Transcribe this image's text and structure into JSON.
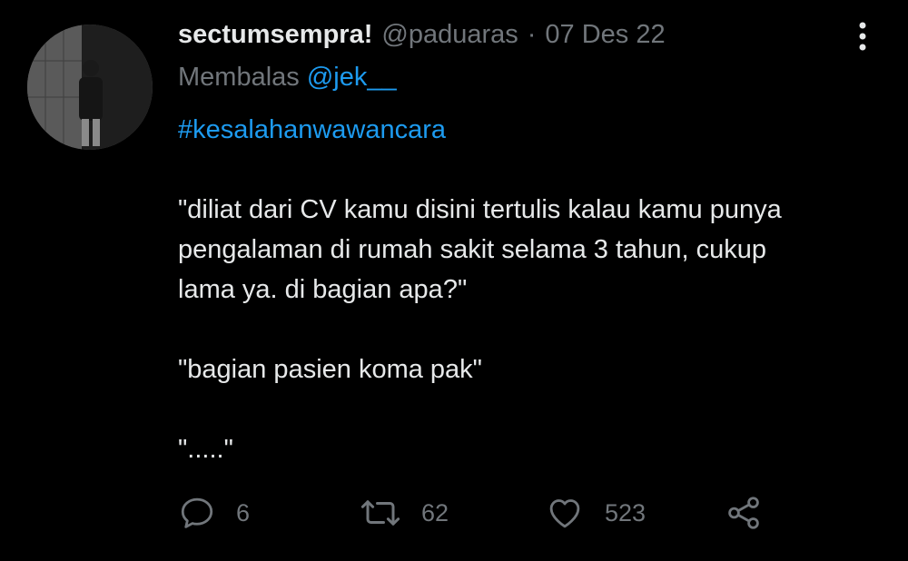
{
  "tweet": {
    "display_name": "sectumsempra!",
    "handle": "@paduaras",
    "separator": "·",
    "date": "07 Des 22",
    "reply_prefix": "Membalas",
    "reply_to": "@jek__",
    "hashtag": "#kesalahanwawancara",
    "body_lines": [
      "\"diliat dari CV kamu disini tertulis kalau kamu punya",
      "pengalaman di rumah sakit selama 3 tahun, cukup",
      "lama ya. di bagian apa?\""
    ],
    "reply_quote": "\"bagian pasien koma pak\"",
    "ending": "\".....\""
  },
  "actions": {
    "reply_icon": "reply-bubble-icon",
    "reply_count": "6",
    "retweet_icon": "retweet-icon",
    "retweet_count": "62",
    "like_icon": "heart-icon",
    "like_count": "523",
    "share_icon": "share-icon"
  },
  "colors": {
    "background": "#000000",
    "text": "#e7e9ea",
    "muted": "#71767b",
    "accent": "#1d9bf0"
  }
}
